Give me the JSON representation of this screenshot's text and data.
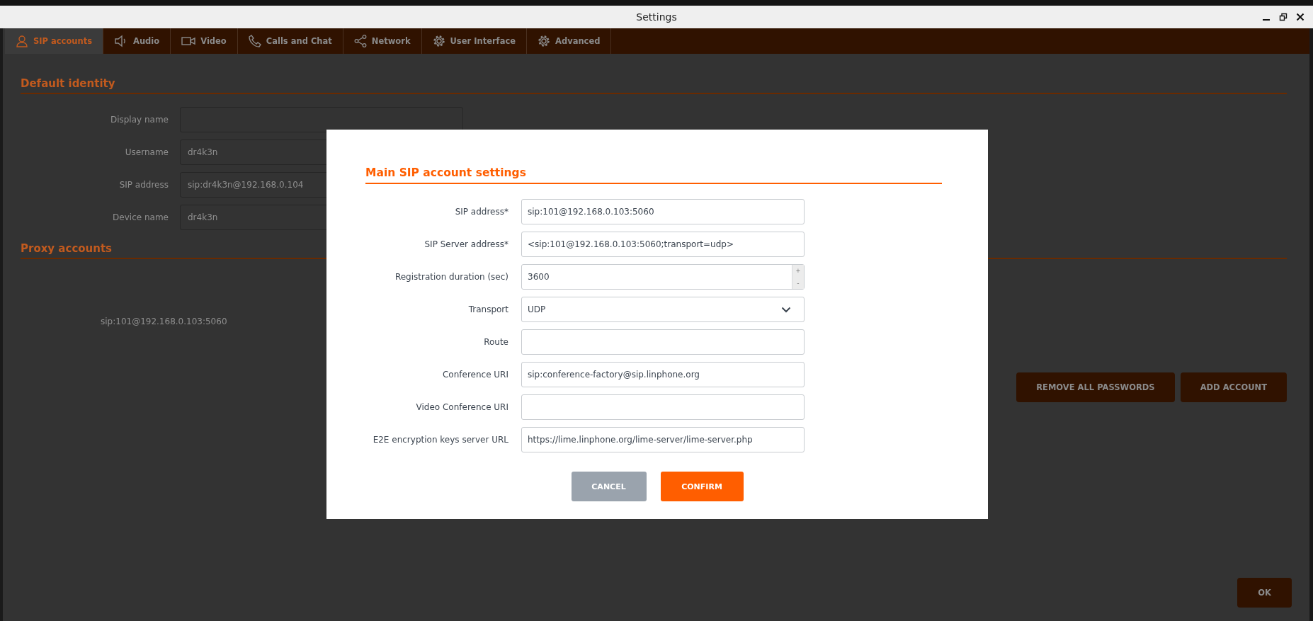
{
  "window": {
    "title": "Settings"
  },
  "tabs": [
    {
      "label": "SIP accounts",
      "selected": true
    },
    {
      "label": "Audio",
      "selected": false
    },
    {
      "label": "Video",
      "selected": false
    },
    {
      "label": "Calls and Chat",
      "selected": false
    },
    {
      "label": "Network",
      "selected": false
    },
    {
      "label": "User Interface",
      "selected": false
    },
    {
      "label": "Advanced",
      "selected": false
    }
  ],
  "default_identity": {
    "heading": "Default identity",
    "fields": [
      {
        "label": "Display name"
      },
      {
        "label": "Username",
        "value": "dr4k3n"
      },
      {
        "label": "SIP address",
        "value": "sip:dr4k3n@192.168.0.104"
      },
      {
        "label": "Device name",
        "value": "dr4k3n"
      }
    ]
  },
  "proxy_accounts": {
    "heading": "Proxy accounts",
    "accounts": [
      {
        "address": "sip:101@192.168.0.103:5060"
      }
    ],
    "buttons": [
      "REMOVE ALL PASSWORDS",
      "ADD ACCOUNT"
    ]
  },
  "ok_button": "OK",
  "dialog": {
    "heading": "Main SIP account settings",
    "fields": [
      {
        "kind": "text",
        "label": "SIP address*",
        "value": "sip:101@192.168.0.103:5060"
      },
      {
        "kind": "text",
        "label": "SIP Server address*",
        "value": "<sip:101@192.168.0.103:5060;transport=udp>"
      },
      {
        "kind": "spin",
        "label": "Registration duration (sec)",
        "value": "3600",
        "increment": "+",
        "decrement": "-"
      },
      {
        "kind": "select",
        "label": "Transport",
        "value": "UDP"
      },
      {
        "kind": "text",
        "label": "Route"
      },
      {
        "kind": "text",
        "label": "Conference URI",
        "value": "sip:conference-factory@sip.linphone.org"
      },
      {
        "kind": "text",
        "label": "Video Conference URI"
      },
      {
        "kind": "text",
        "label": "E2E encryption keys server URL",
        "value": "https://lime.linphone.org/lime-server/lime-server.php"
      }
    ],
    "buttons": [
      {
        "kind": "secondary",
        "label": "CANCEL"
      },
      {
        "kind": "primary",
        "label": "CONFIRM"
      }
    ]
  }
}
